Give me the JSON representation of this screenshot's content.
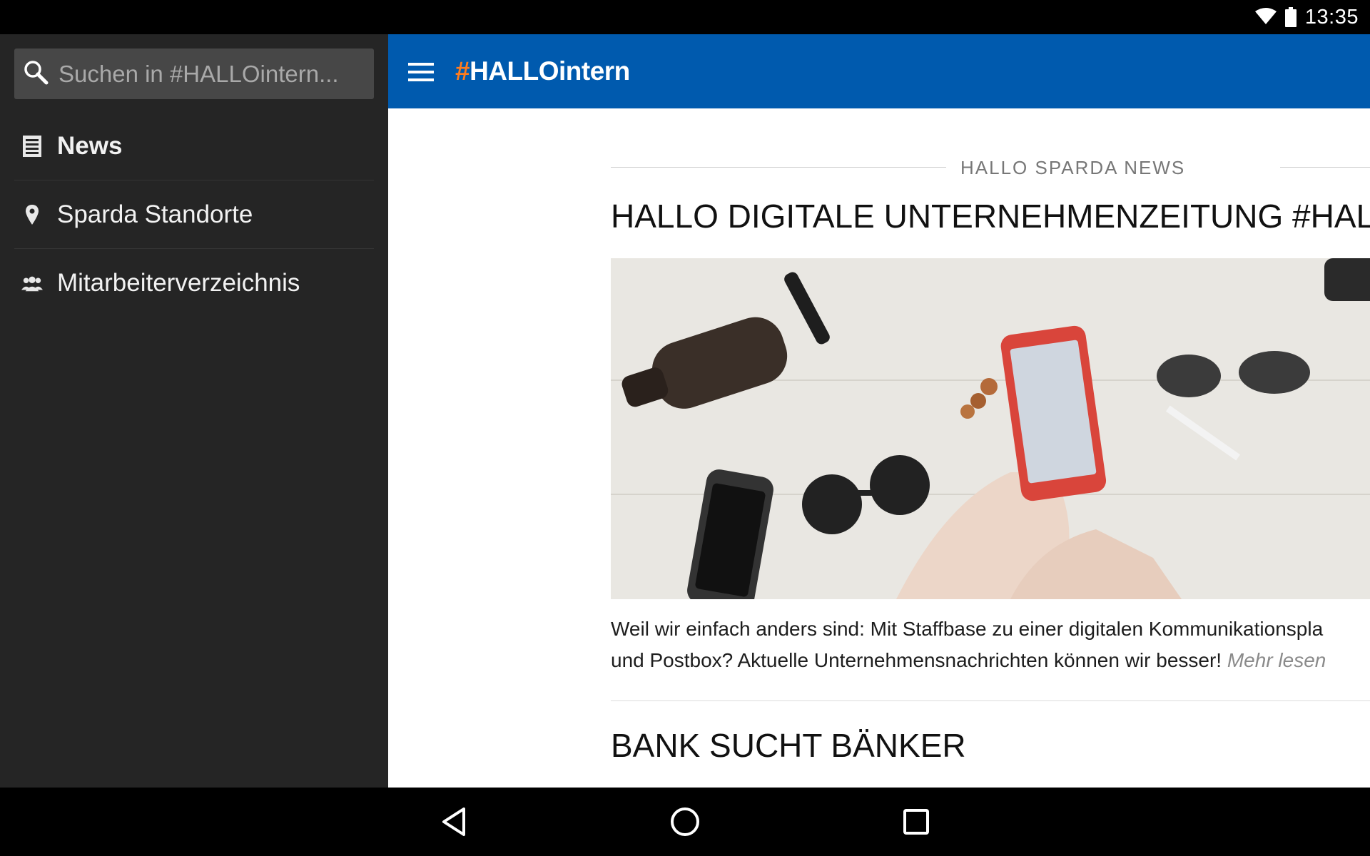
{
  "status": {
    "time": "13:35",
    "wifi_icon": "wifi-icon",
    "battery_icon": "battery-icon"
  },
  "drawer": {
    "search": {
      "placeholder": "Suchen in #HALLOintern...",
      "icon": "search-icon"
    },
    "items": [
      {
        "label": "News",
        "icon": "news-icon",
        "active": true
      },
      {
        "label": "Sparda Standorte",
        "icon": "location-pin-icon",
        "active": false
      },
      {
        "label": "Mitarbeiterverzeichnis",
        "icon": "people-icon",
        "active": false
      }
    ]
  },
  "appbar": {
    "hash": "#",
    "title": "HALLOintern",
    "menu_icon": "hamburger-menu-icon"
  },
  "colors": {
    "appbar": "#005aae",
    "accent": "#ff7c1e",
    "drawer": "#252525"
  },
  "feed": {
    "section_title": "HALLO SPARDA NEWS",
    "articles": [
      {
        "title": "HALLO DIGITALE UNTERNEHMENZEITUNG #HALL",
        "text_line1": "Weil wir einfach anders sind: Mit Staffbase zu einer digitalen Kommunikationspla",
        "text_line2": "und Postbox? Aktuelle Unternehmensnachrichten können wir besser!",
        "more": "Mehr lesen"
      },
      {
        "title": "BANK SUCHT BÄNKER"
      }
    ]
  },
  "navbar": {
    "back_icon": "back-icon",
    "home_icon": "home-icon",
    "recents_icon": "recents-icon"
  }
}
